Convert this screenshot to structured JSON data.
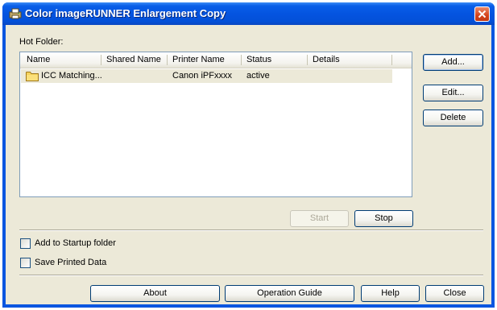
{
  "window": {
    "title": "Color imageRUNNER Enlargement Copy"
  },
  "hot_folder": {
    "label": "Hot Folder:",
    "columns": [
      "Name",
      "Shared Name",
      "Printer Name",
      "Status",
      "Details"
    ],
    "rows": [
      {
        "name": "ICC Matching...",
        "shared_name": "",
        "printer_name": "Canon iPFxxxx",
        "status": "active",
        "details": ""
      }
    ]
  },
  "side_buttons": {
    "add": "Add...",
    "edit": "Edit...",
    "delete": "Delete"
  },
  "list_buttons": {
    "start": "Start",
    "stop": "Stop"
  },
  "options": {
    "add_to_startup": {
      "label": "Add to Startup folder",
      "checked": false
    },
    "save_printed_data": {
      "label": "Save Printed Data",
      "checked": false
    }
  },
  "footer": {
    "about": "About",
    "operation_guide": "Operation Guide",
    "help": "Help",
    "close": "Close"
  }
}
